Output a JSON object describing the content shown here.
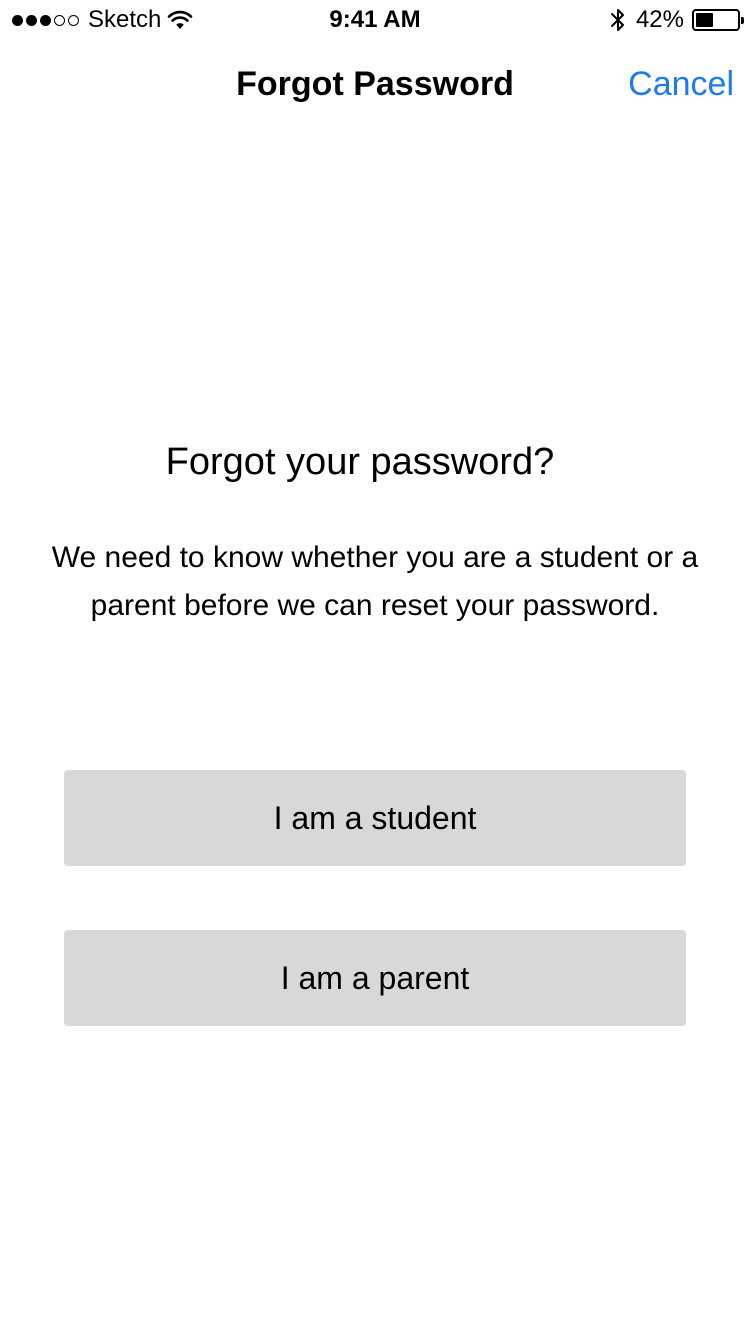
{
  "status_bar": {
    "carrier": "Sketch",
    "signal_bars_total": 5,
    "signal_bars_filled": 3,
    "time": "9:41 AM",
    "battery_percent_label": "42%",
    "battery_level": 0.42,
    "icons": [
      "wifi-icon",
      "bluetooth-icon",
      "battery-icon"
    ]
  },
  "nav_bar": {
    "title": "Forgot Password",
    "cancel_label": "Cancel",
    "cancel_color": "#1a7cf2"
  },
  "content": {
    "heading": "Forgot your password?",
    "description": "We need to know whether you are a student or a parent before we can reset your password.",
    "student_button_label": "I am a student",
    "parent_button_label": "I am a parent",
    "button_color": "#d8d8d8"
  }
}
